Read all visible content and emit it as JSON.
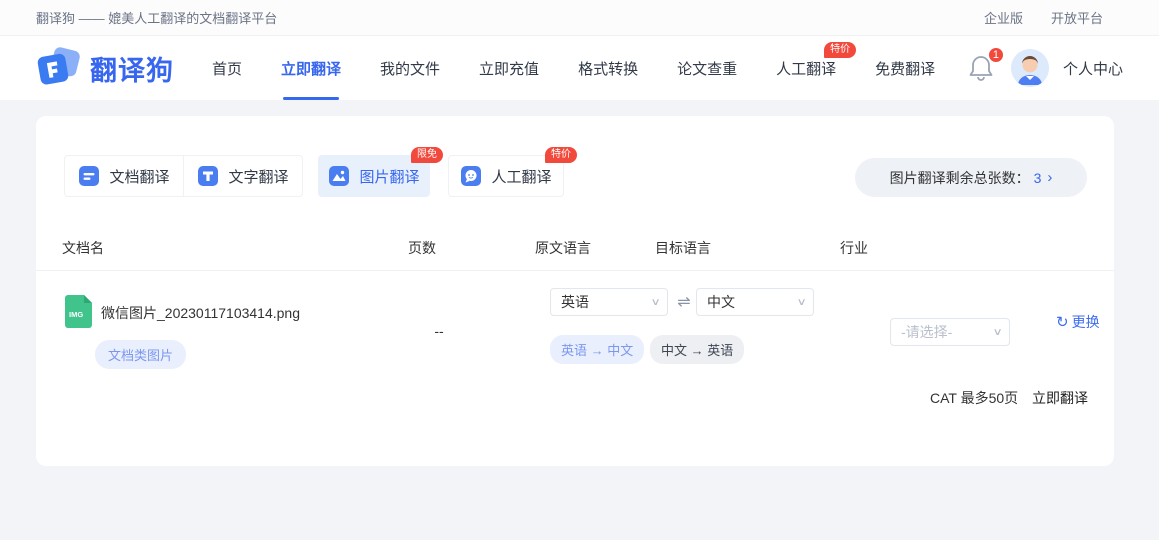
{
  "topbar": {
    "tagline": "翻译狗 —— 媲美人工翻译的文档翻译平台",
    "links": [
      {
        "label": "企业版"
      },
      {
        "label": "开放平台"
      }
    ]
  },
  "header": {
    "logo_text": "翻译狗",
    "nav": [
      {
        "label": "首页",
        "active": false
      },
      {
        "label": "立即翻译",
        "active": true
      },
      {
        "label": "我的文件",
        "active": false
      },
      {
        "label": "立即充值",
        "active": false
      },
      {
        "label": "格式转换",
        "active": false
      },
      {
        "label": "论文查重",
        "active": false
      },
      {
        "label": "人工翻译",
        "active": false,
        "badge": "特价"
      },
      {
        "label": "免费翻译",
        "active": false
      }
    ],
    "notification_count": "1",
    "user_label": "个人中心"
  },
  "tabs": [
    {
      "label": "文档翻译",
      "icon": "document-icon",
      "active": false
    },
    {
      "label": "文字翻译",
      "icon": "text-icon",
      "active": false
    },
    {
      "label": "图片翻译",
      "icon": "image-icon",
      "active": true,
      "badge": "限免"
    },
    {
      "label": "人工翻译",
      "icon": "chat-icon",
      "active": false,
      "badge": "特价"
    }
  ],
  "quota": {
    "label": "图片翻译剩余总张数：",
    "value": "3",
    "chevron": "›"
  },
  "table": {
    "headers": [
      "文档名",
      "页数",
      "原文语言",
      "目标语言",
      "行业"
    ],
    "row": {
      "file_type_badge": "IMG",
      "filename": "微信图片_20230117103414.png",
      "file_tag": "文档类图片",
      "pages": "--",
      "source_lang": "英语",
      "target_lang": "中文",
      "quick_pairs": [
        {
          "label": "英语 → 中文",
          "active": true
        },
        {
          "label": "中文 → 英语",
          "active": false
        }
      ],
      "industry_placeholder": "-请选择-",
      "change_label": "更换",
      "cat_note": "CAT 最多50页",
      "translate_label": "立即翻译"
    }
  },
  "icons": {
    "swap": "⇌",
    "refresh": "↻",
    "chevron_down": "∨",
    "quota_chevron": "›"
  },
  "colors": {
    "primary_blue": "#3766ef",
    "badge_red": "#f2493d",
    "active_tab_bg": "#e8f0fc",
    "file_icon_green": "#40c48c",
    "tag_blue_bg": "#e9effc",
    "tag_blue_text": "#7c97f0",
    "tag_gray_bg": "#edeff3",
    "quota_pill_bg": "#eef1f6",
    "page_bg": "#f2f4f8"
  }
}
